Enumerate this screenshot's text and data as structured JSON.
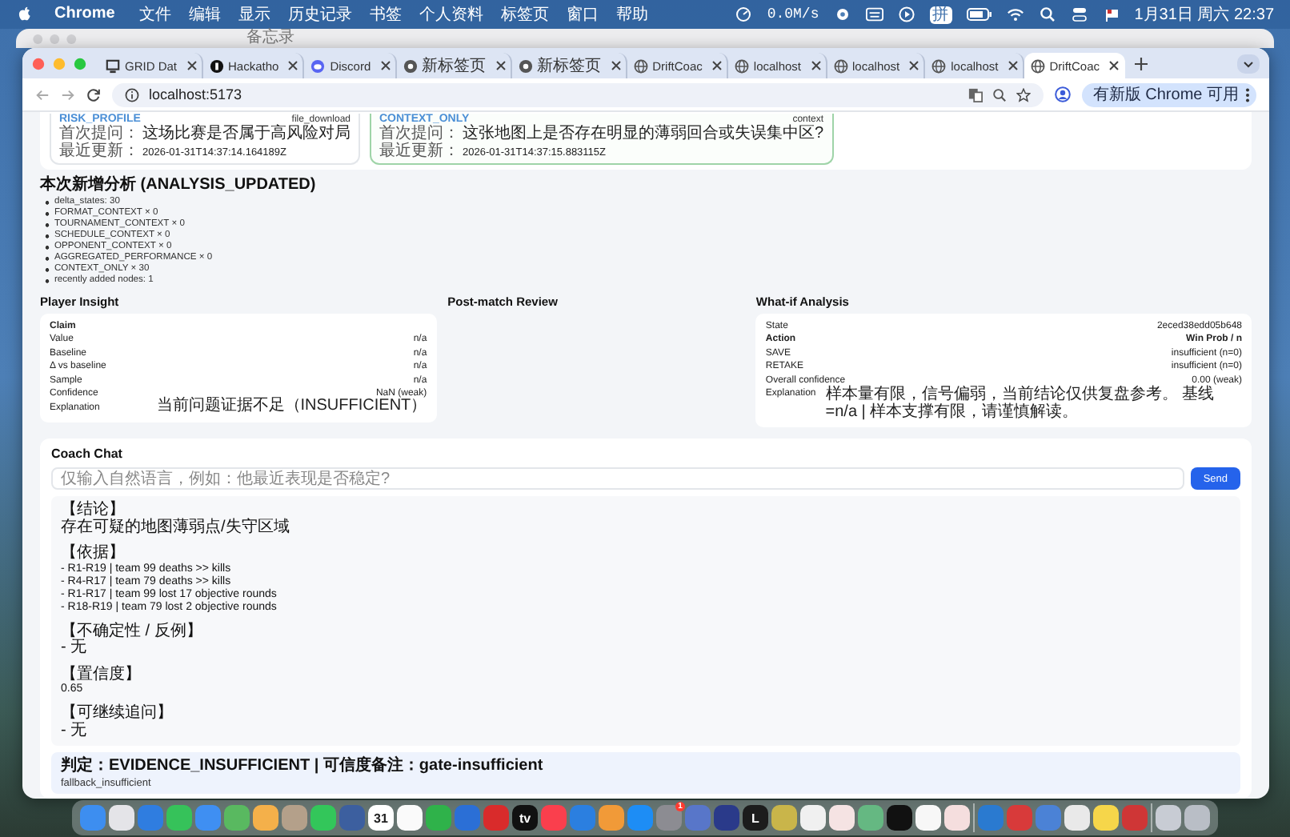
{
  "menu_bar": {
    "app": "Chrome",
    "menus": [
      "文件",
      "编辑",
      "显示",
      "历史记录",
      "书签",
      "个人资料",
      "标签页",
      "窗口",
      "帮助"
    ],
    "net_speed": "0.0M/s",
    "input_method": "拼",
    "clock": "1月31日 周六 22:37"
  },
  "back_window": {
    "title": "备忘录"
  },
  "tabs": [
    {
      "title": "GRID Dat",
      "kind": "grid",
      "selected": false
    },
    {
      "title": "Hackatho",
      "kind": "dark",
      "selected": false
    },
    {
      "title": "Discord",
      "kind": "discord",
      "selected": false
    },
    {
      "title": "新标签页",
      "kind": "chrome",
      "selected": false
    },
    {
      "title": "新标签页",
      "kind": "chrome",
      "selected": false
    },
    {
      "title": "DriftCoac",
      "kind": "globe",
      "selected": false
    },
    {
      "title": "localhost",
      "kind": "globe",
      "selected": false
    },
    {
      "title": "localhost",
      "kind": "globe",
      "selected": false
    },
    {
      "title": "localhost",
      "kind": "globe",
      "selected": false
    },
    {
      "title": "DriftCoac",
      "kind": "globe",
      "selected": true
    }
  ],
  "address": "localhost:5173",
  "update_button": "有新版 Chrome 可用",
  "context_cards": [
    {
      "type": "RISK_PROFILE",
      "tag": "file_download",
      "question_label": "首次提问：",
      "question": "这场比赛是否属于高风险对局",
      "updated_label": "最近更新：",
      "updated": "2026-01-31T14:37:14.164189Z",
      "selected": false
    },
    {
      "type": "CONTEXT_ONLY",
      "tag": "context",
      "question_label": "首次提问：",
      "question": "这张地图上是否存在明显的薄弱回合或失误集中区?",
      "updated_label": "最近更新：",
      "updated": "2026-01-31T14:37:15.883115Z",
      "selected": true
    }
  ],
  "analysis": {
    "title": "本次新增分析 (ANALYSIS_UPDATED)",
    "items": [
      "delta_states: 30",
      "FORMAT_CONTEXT × 0",
      "TOURNAMENT_CONTEXT × 0",
      "SCHEDULE_CONTEXT × 0",
      "OPPONENT_CONTEXT × 0",
      "AGGREGATED_PERFORMANCE × 0",
      "CONTEXT_ONLY × 30",
      "recently added nodes: 1"
    ]
  },
  "player_insight": {
    "title": "Player Insight",
    "rows": [
      {
        "kind": "heading",
        "label": "Claim"
      },
      {
        "kind": "row",
        "label": "Value",
        "value": "n/a"
      },
      {
        "kind": "row",
        "label": "Baseline",
        "value": "n/a"
      },
      {
        "kind": "row",
        "label": "Δ vs baseline",
        "value": "n/a"
      },
      {
        "kind": "row",
        "label": "Sample",
        "value": "n/a"
      },
      {
        "kind": "row",
        "label": "Confidence",
        "value": "NaN (weak)"
      },
      {
        "kind": "row",
        "label": "Explanation",
        "value": "当前问题证据不足（INSUFFICIENT）"
      }
    ]
  },
  "post_match_review": {
    "title": "Post-match Review"
  },
  "what_if": {
    "title": "What-if Analysis",
    "rows": [
      {
        "kind": "row",
        "label": "State",
        "value": "2eced38edd05b648"
      },
      {
        "kind": "heading",
        "label": "Action",
        "value": "Win Prob / n"
      },
      {
        "kind": "row",
        "label": "SAVE",
        "value": "insufficient (n=0)"
      },
      {
        "kind": "row",
        "label": "RETAKE",
        "value": "insufficient (n=0)"
      },
      {
        "kind": "row",
        "label": "Overall confidence",
        "value": "0.00 (weak)"
      },
      {
        "kind": "text",
        "label": "Explanation",
        "value": "样本量有限，信号偏弱，当前结论仅供复盘参考。 基线=n/a | 样本支撑有限，请谨慎解读。"
      }
    ]
  },
  "coach_chat": {
    "title": "Coach Chat",
    "input": {
      "placeholder": "仅输入自然语言，例如：他最近表现是否稳定?"
    },
    "send": "Send",
    "answer": [
      {
        "heading": "【结论】",
        "lines": [
          "存在可疑的地图薄弱点/失守区域"
        ]
      },
      {
        "heading": "【依据】",
        "lines": [
          "- R1-R19 | team 99 deaths >> kills",
          "- R4-R17 | team 79 deaths >> kills",
          "- R1-R17 | team 99 lost 17 objective rounds",
          "- R18-R19 | team 79 lost 2 objective rounds"
        ]
      },
      {
        "heading": "【不确定性 / 反例】",
        "lines": [
          "- 无"
        ]
      },
      {
        "heading": "【置信度】",
        "lines": [
          "0.65"
        ]
      },
      {
        "heading": "【可继续追问】",
        "lines": [
          "- 无"
        ]
      }
    ],
    "verdict": {
      "title": "判定：EVIDENCE_INSUFFICIENT | 可信度备注：gate-insufficient",
      "detail": "fallback_insufficient"
    }
  },
  "dock": [
    {
      "kind": "app",
      "color": "#3d8ef0"
    },
    {
      "kind": "app",
      "color": "#e4e4e8"
    },
    {
      "kind": "app",
      "color": "#2f7de0"
    },
    {
      "kind": "app",
      "color": "#36c25a"
    },
    {
      "kind": "app",
      "color": "#3f8ff2"
    },
    {
      "kind": "app",
      "color": "#59b960"
    },
    {
      "kind": "app",
      "color": "#f4b04a"
    },
    {
      "kind": "app",
      "color": "#b4a08a"
    },
    {
      "kind": "app",
      "color": "#33c65a"
    },
    {
      "kind": "app",
      "color": "#3c5f9f"
    },
    {
      "kind": "app",
      "color": "#ffffff",
      "label": "31"
    },
    {
      "kind": "app",
      "color": "#fafafa"
    },
    {
      "kind": "app",
      "color": "#2fb24a"
    },
    {
      "kind": "app",
      "color": "#2b6fd6"
    },
    {
      "kind": "app",
      "color": "#d92b2b"
    },
    {
      "kind": "app",
      "color": "#111111",
      "label": "tv"
    },
    {
      "kind": "app",
      "color": "#fa3f4d"
    },
    {
      "kind": "app",
      "color": "#2b7fe0"
    },
    {
      "kind": "app",
      "color": "#f19a38"
    },
    {
      "kind": "app",
      "color": "#1d8df5"
    },
    {
      "kind": "app",
      "color": "#8c8c92",
      "badge": "1"
    },
    {
      "kind": "app",
      "color": "#5876c9"
    },
    {
      "kind": "app",
      "color": "#2a3a8a"
    },
    {
      "kind": "app",
      "color": "#1c1c1c",
      "label": "L"
    },
    {
      "kind": "app",
      "color": "#c9b54a"
    },
    {
      "kind": "app",
      "color": "#f0f0f0"
    },
    {
      "kind": "app",
      "color": "#f5e3e3"
    },
    {
      "kind": "app",
      "color": "#65b882"
    },
    {
      "kind": "app",
      "color": "#111111"
    },
    {
      "kind": "app",
      "color": "#f7f7f7"
    },
    {
      "kind": "app",
      "color": "#f5dede"
    },
    {
      "kind": "separator"
    },
    {
      "kind": "app",
      "color": "#2a7ad0"
    },
    {
      "kind": "app",
      "color": "#d83a3a"
    },
    {
      "kind": "app",
      "color": "#4b82d6"
    },
    {
      "kind": "app",
      "color": "#e9e9e9"
    },
    {
      "kind": "app",
      "color": "#f6d64a"
    },
    {
      "kind": "app",
      "color": "#cf3636"
    },
    {
      "kind": "separator"
    },
    {
      "kind": "app",
      "color": "#c8ccd4"
    },
    {
      "kind": "app",
      "color": "#b9bec6"
    }
  ]
}
